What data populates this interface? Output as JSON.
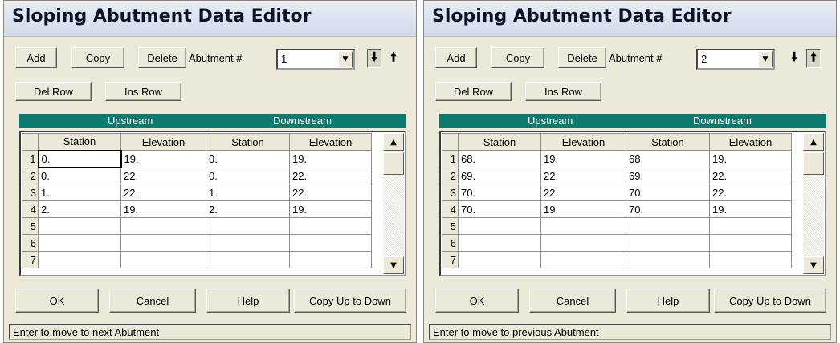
{
  "panels": [
    {
      "title": "Sloping Abutment Data Editor",
      "buttons": {
        "add": "Add",
        "copy": "Copy",
        "delete": "Delete",
        "del_row": "Del Row",
        "ins_row": "Ins Row",
        "ok": "OK",
        "cancel": "Cancel",
        "help": "Help",
        "copy_up_down": "Copy Up to Down"
      },
      "abutment_label": "Abutment #",
      "abutment_value": "1",
      "pressed_arrow": "down",
      "section_upstream": "Upstream",
      "section_downstream": "Downstream",
      "columns": [
        "Station",
        "Elevation",
        "Station",
        "Elevation"
      ],
      "rows": [
        {
          "n": "1",
          "c": [
            "0.",
            "19.",
            "0.",
            "19."
          ]
        },
        {
          "n": "2",
          "c": [
            "0.",
            "22.",
            "0.",
            "22."
          ]
        },
        {
          "n": "3",
          "c": [
            "1.",
            "22.",
            "1.",
            "22."
          ]
        },
        {
          "n": "4",
          "c": [
            "2.",
            "19.",
            "2.",
            "19."
          ]
        },
        {
          "n": "5",
          "c": [
            "",
            "",
            "",
            ""
          ]
        },
        {
          "n": "6",
          "c": [
            "",
            "",
            "",
            ""
          ]
        },
        {
          "n": "7",
          "c": [
            "",
            "",
            "",
            ""
          ]
        }
      ],
      "status": "Enter to move to next Abutment"
    },
    {
      "title": "Sloping Abutment Data Editor",
      "buttons": {
        "add": "Add",
        "copy": "Copy",
        "delete": "Delete",
        "del_row": "Del Row",
        "ins_row": "Ins Row",
        "ok": "OK",
        "cancel": "Cancel",
        "help": "Help",
        "copy_up_down": "Copy Up to Down"
      },
      "abutment_label": "Abutment #",
      "abutment_value": "2",
      "pressed_arrow": "up",
      "section_upstream": "Upstream",
      "section_downstream": "Downstream",
      "columns": [
        "Station",
        "Elevation",
        "Station",
        "Elevation"
      ],
      "rows": [
        {
          "n": "1",
          "c": [
            "68.",
            "19.",
            "68.",
            "19."
          ]
        },
        {
          "n": "2",
          "c": [
            "69.",
            "22.",
            "69.",
            "22."
          ]
        },
        {
          "n": "3",
          "c": [
            "70.",
            "22.",
            "70.",
            "22."
          ]
        },
        {
          "n": "4",
          "c": [
            "70.",
            "19.",
            "70.",
            "19."
          ]
        },
        {
          "n": "5",
          "c": [
            "",
            "",
            "",
            ""
          ]
        },
        {
          "n": "6",
          "c": [
            "",
            "",
            "",
            ""
          ]
        },
        {
          "n": "7",
          "c": [
            "",
            "",
            "",
            ""
          ]
        }
      ],
      "status": "Enter to move to previous Abutment"
    }
  ],
  "colors": {
    "header_teal": "#0d7a70",
    "dialog_bg": "#ece9d8"
  },
  "icons": {
    "arrow_down": "down-arrow-icon",
    "arrow_up": "up-arrow-icon",
    "combo_drop": "triangle-down-icon"
  }
}
